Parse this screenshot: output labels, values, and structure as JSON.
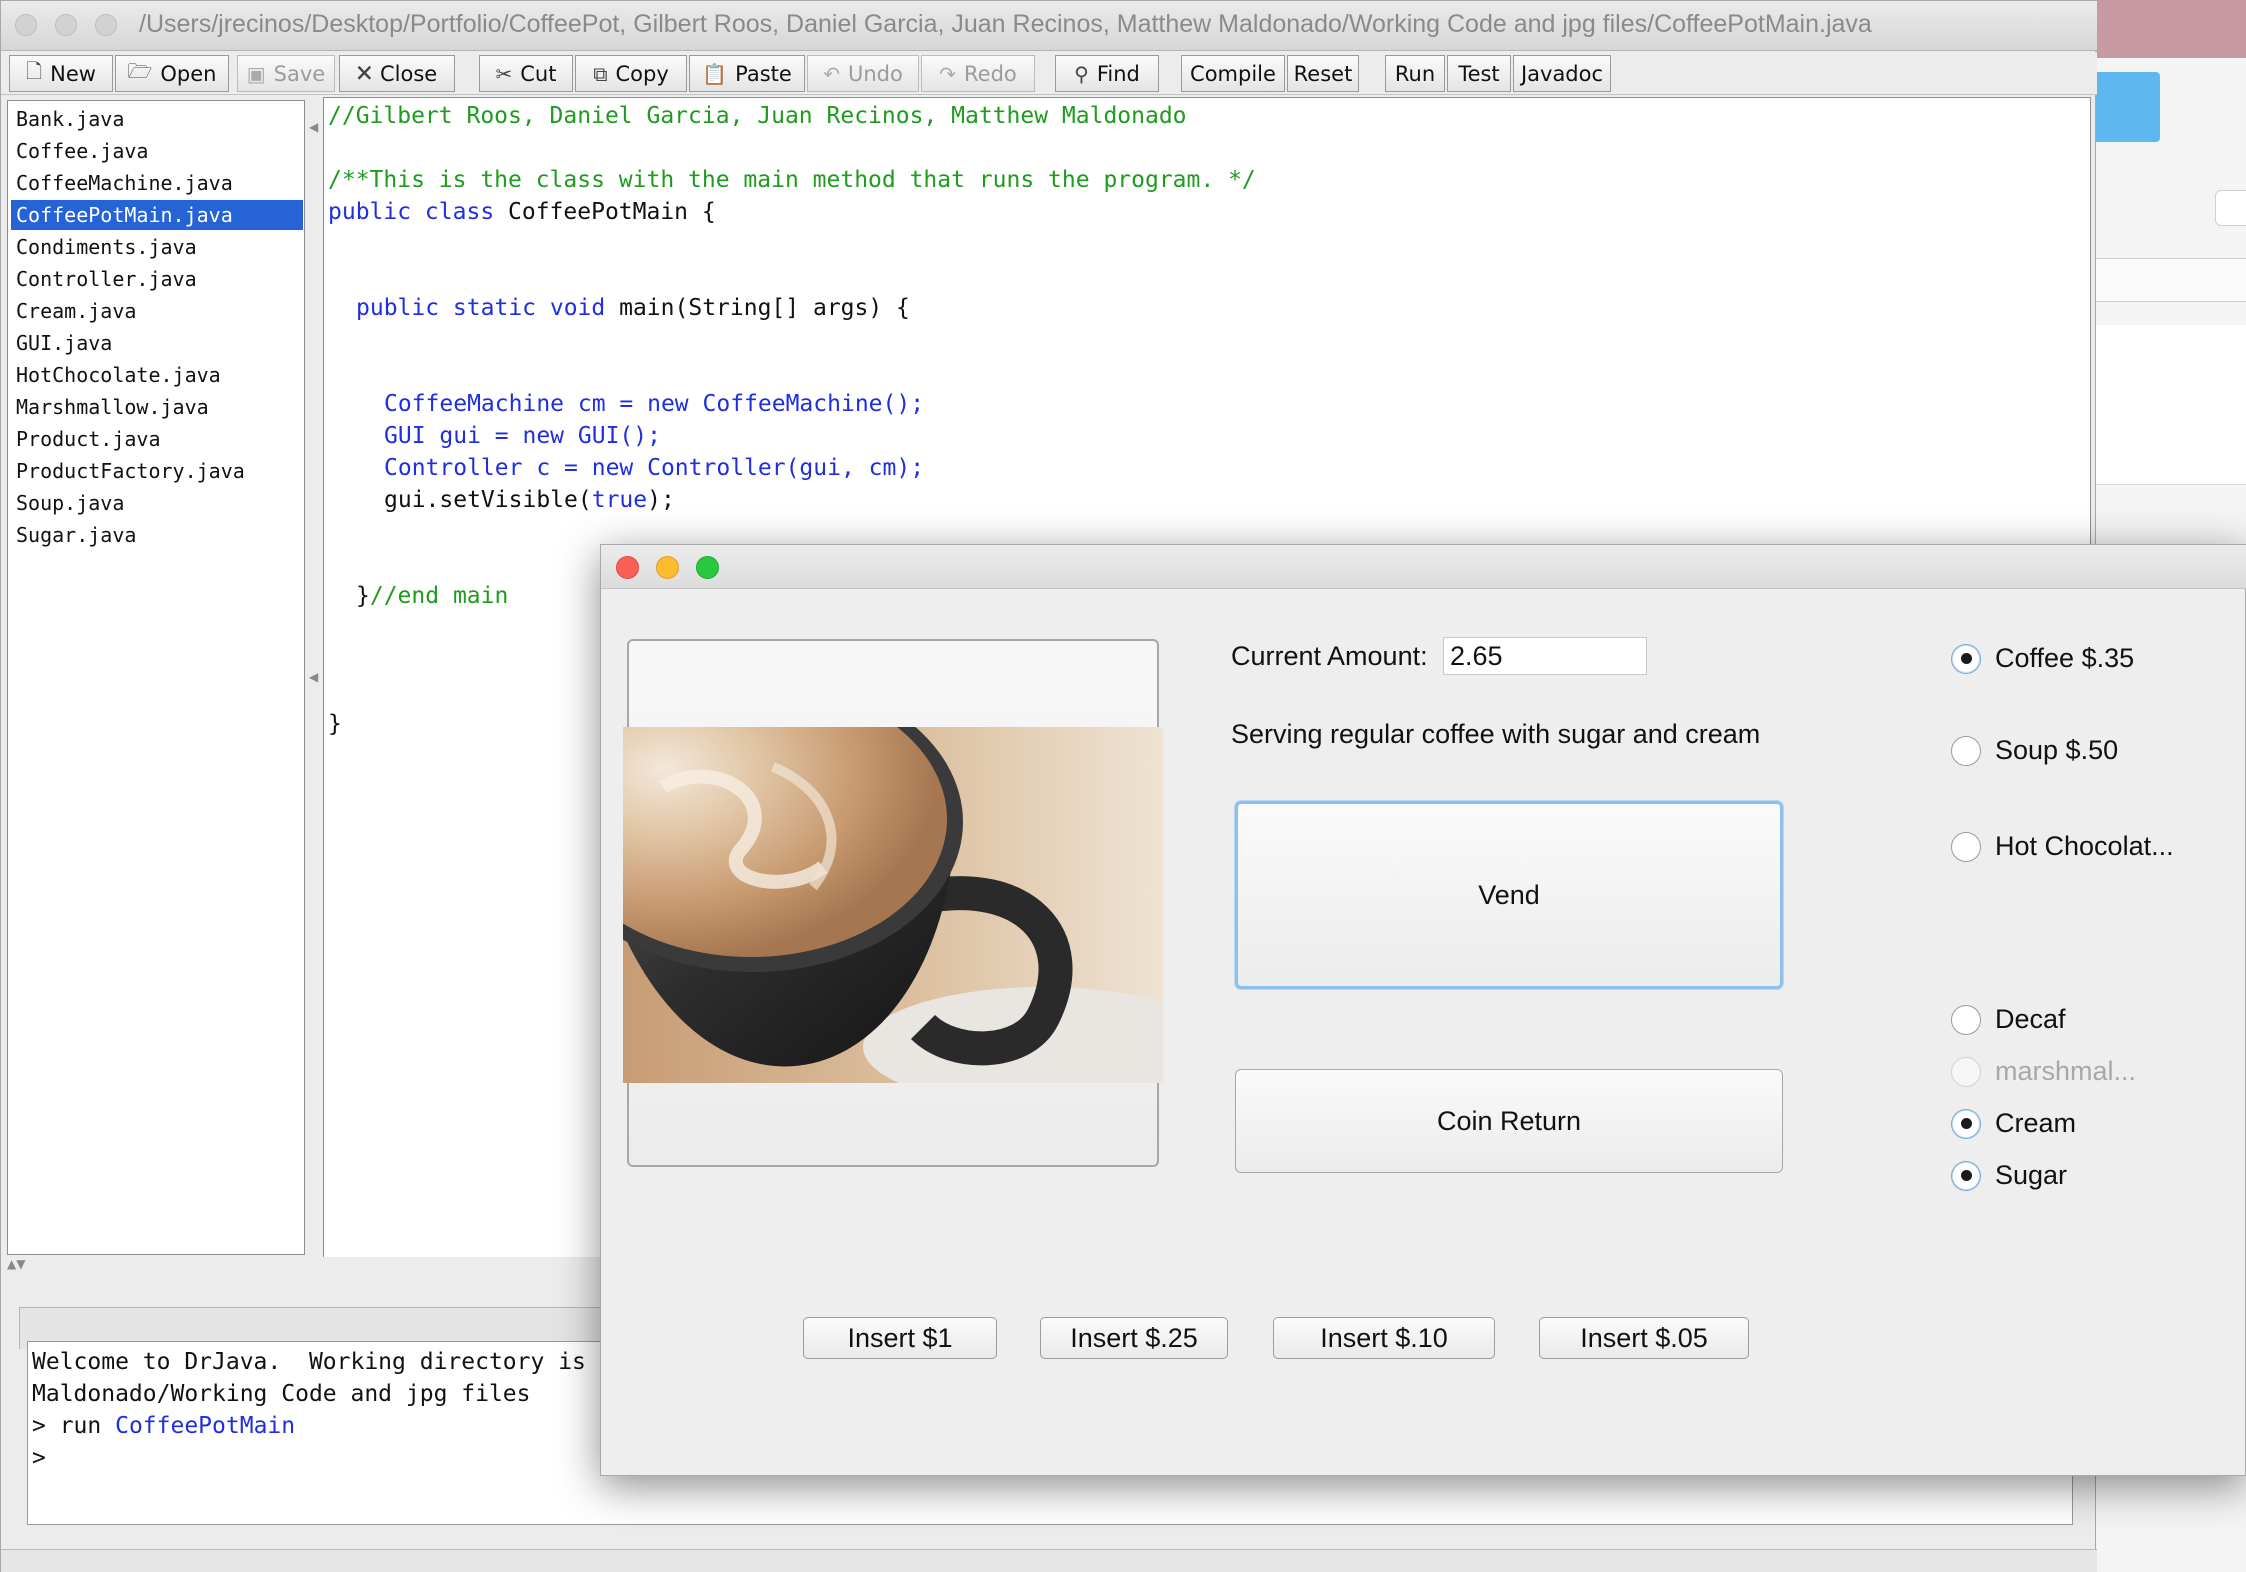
{
  "drjava": {
    "title": "/Users/jrecinos/Desktop/Portfolio/CoffeePot, Gilbert Roos, Daniel Garcia, Juan Recinos, Matthew Maldonado/Working Code and jpg files/CoffeePotMain.java",
    "toolbar": {
      "new": "New",
      "open": "Open",
      "save": "Save",
      "close": "Close",
      "cut": "Cut",
      "copy": "Copy",
      "paste": "Paste",
      "undo": "Undo",
      "redo": "Redo",
      "find": "Find",
      "compile": "Compile",
      "reset": "Reset",
      "run": "Run",
      "test": "Test",
      "javadoc": "Javadoc"
    },
    "files": [
      "Bank.java",
      "Coffee.java",
      "CoffeeMachine.java",
      "CoffeePotMain.java",
      "Condiments.java",
      "Controller.java",
      "Cream.java",
      "GUI.java",
      "HotChocolate.java",
      "Marshmallow.java",
      "Product.java",
      "ProductFactory.java",
      "Soup.java",
      "Sugar.java"
    ],
    "selected_file": "CoffeePotMain.java",
    "code": {
      "l1": "//Gilbert Roos, Daniel Garcia, Juan Recinos, Matthew Maldonado",
      "l3": "/**This is the class with the main method that runs the program. */",
      "l4_kw": "public class ",
      "l4_tx": "CoffeePotMain {",
      "l7_kw": "public static void ",
      "l7_tx": "main(String[] args) {",
      "l10a": "CoffeeMachine cm = ",
      "l10b": "new ",
      "l10c": "CoffeeMachine();",
      "l11a": "GUI gui = ",
      "l11b": "new ",
      "l11c": "GUI();",
      "l12a": "Controller c = ",
      "l12b": "new ",
      "l12c": "Controller(gui, cm);",
      "l13a": "gui.setVisible(",
      "l13b": "true",
      "l13c": ");",
      "l16a": "}",
      "l16b": "//end main",
      "l20": "}"
    },
    "console": {
      "line1": "Welcome to DrJava.  Working directory is",
      "line2": "Maldonado/Working Code and jpg files",
      "line3_prompt": "> run ",
      "line3_cmd": "CoffeePotMain",
      "line4": ">"
    }
  },
  "gui": {
    "amount_label": "Current Amount:",
    "amount_value": "2.65",
    "message": "Serving regular coffee with sugar and cream",
    "vend": "Vend",
    "coin_return": "Coin Return",
    "products": [
      {
        "label": "Coffee $.35",
        "selected": true
      },
      {
        "label": "Soup $.50",
        "selected": false
      },
      {
        "label": "Hot Chocolat...",
        "selected": false
      }
    ],
    "condiments": [
      {
        "label": "Decaf",
        "selected": false,
        "enabled": true
      },
      {
        "label": "marshmal...",
        "selected": false,
        "enabled": false
      },
      {
        "label": "Cream",
        "selected": true,
        "enabled": true
      },
      {
        "label": "Sugar",
        "selected": true,
        "enabled": true
      }
    ],
    "inserts": [
      "Insert $1",
      "Insert $.25",
      "Insert $.10",
      "Insert $.05"
    ]
  },
  "colors": {
    "selection": "#2563d6",
    "comment": "#1f9b1f",
    "keyword": "#1f2fe0",
    "close_light": "#fc5f57",
    "minimize_light": "#fdbc2e",
    "zoom_light": "#28c840"
  }
}
